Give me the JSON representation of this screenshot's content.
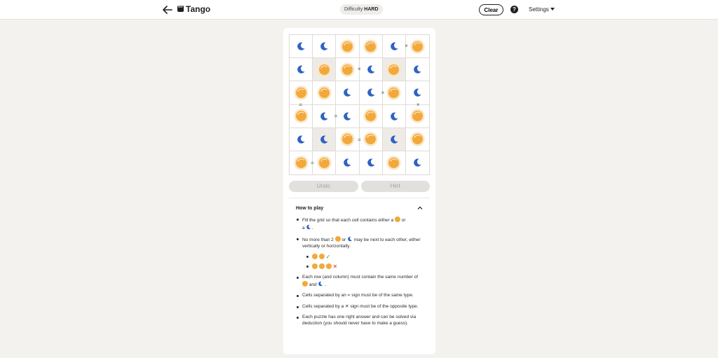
{
  "header": {
    "app_name": "Tango",
    "difficulty_label": "Difficulty",
    "difficulty_value": "HARD",
    "clear_label": "Clear",
    "help_label": "?",
    "settings_label": "Settings"
  },
  "colors": {
    "sun": "#f2a93b",
    "moon": "#2f62c4",
    "locked_cell": "#eeebe6"
  },
  "board": {
    "rows": [
      [
        {
          "s": "moon",
          "locked": false
        },
        {
          "s": "moon",
          "locked": false
        },
        {
          "s": "sun",
          "locked": false
        },
        {
          "s": "sun",
          "locked": false
        },
        {
          "s": "moon",
          "locked": false
        },
        {
          "s": "sun",
          "locked": false
        }
      ],
      [
        {
          "s": "moon",
          "locked": false
        },
        {
          "s": "sun",
          "locked": true
        },
        {
          "s": "sun",
          "locked": false
        },
        {
          "s": "moon",
          "locked": false
        },
        {
          "s": "sun",
          "locked": true
        },
        {
          "s": "moon",
          "locked": false
        }
      ],
      [
        {
          "s": "sun",
          "locked": false
        },
        {
          "s": "sun",
          "locked": false
        },
        {
          "s": "moon",
          "locked": false
        },
        {
          "s": "moon",
          "locked": false
        },
        {
          "s": "sun",
          "locked": false
        },
        {
          "s": "moon",
          "locked": false
        }
      ],
      [
        {
          "s": "sun",
          "locked": false
        },
        {
          "s": "moon",
          "locked": false
        },
        {
          "s": "moon",
          "locked": false
        },
        {
          "s": "sun",
          "locked": false
        },
        {
          "s": "moon",
          "locked": false
        },
        {
          "s": "sun",
          "locked": false
        }
      ],
      [
        {
          "s": "moon",
          "locked": false
        },
        {
          "s": "moon",
          "locked": true
        },
        {
          "s": "sun",
          "locked": false
        },
        {
          "s": "sun",
          "locked": false
        },
        {
          "s": "moon",
          "locked": true
        },
        {
          "s": "sun",
          "locked": false
        }
      ],
      [
        {
          "s": "sun",
          "locked": false
        },
        {
          "s": "sun",
          "locked": false
        },
        {
          "s": "moon",
          "locked": false
        },
        {
          "s": "moon",
          "locked": false
        },
        {
          "s": "sun",
          "locked": false
        },
        {
          "s": "moon",
          "locked": false
        }
      ]
    ],
    "constraints": [
      {
        "type": "h",
        "row": 0,
        "col": 4,
        "symbol": "×"
      },
      {
        "type": "h",
        "row": 1,
        "col": 2,
        "symbol": "×"
      },
      {
        "type": "h",
        "row": 2,
        "col": 3,
        "symbol": "×"
      },
      {
        "type": "v",
        "row": 2,
        "col": 0,
        "symbol": "="
      },
      {
        "type": "v",
        "row": 2,
        "col": 5,
        "symbol": "×"
      },
      {
        "type": "h",
        "row": 3,
        "col": 1,
        "symbol": "="
      },
      {
        "type": "h",
        "row": 4,
        "col": 2,
        "symbol": "="
      },
      {
        "type": "h",
        "row": 5,
        "col": 0,
        "symbol": "="
      }
    ]
  },
  "controls": {
    "undo_label": "Undo",
    "hint_label": "Hint"
  },
  "how_to_play": {
    "title": "How to play",
    "rule1_a": "Fill the grid so that each cell contains either a",
    "rule1_b": "or",
    "rule1_c": "a",
    "rule1_d": ".",
    "rule2_a": "No more than 2",
    "rule2_b": "or",
    "rule2_c": "may be next to each other, either vertically or horizontally.",
    "check_mark": "✓",
    "cross_mark": "✕",
    "rule3_a": "Each row (and column) must contain the same number of",
    "rule3_b": "and",
    "rule3_c": ".",
    "rule4": "Cells separated by an = sign must be of the same type.",
    "rule5_a": "Cells separated by a",
    "rule5_x": "✕",
    "rule5_b": "sign must be of the opposite type.",
    "rule6": "Each puzzle has one right answer and can be solved via deduction (you should never have to make a guess)."
  }
}
